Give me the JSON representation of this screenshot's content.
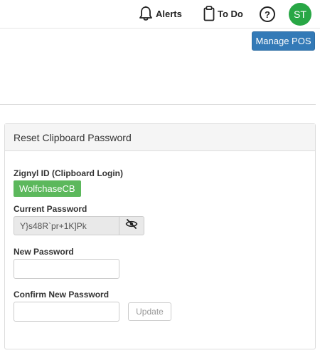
{
  "header": {
    "alerts_label": "Alerts",
    "todo_label": "To Do",
    "help_label": "?",
    "avatar_initials": "ST",
    "avatar_color": "#28a745"
  },
  "actions": {
    "manage_pos_label": "Manage POS",
    "accent_color": "#337ab7"
  },
  "panel": {
    "title": "Reset Clipboard Password",
    "zignyl_id_label": "Zignyl ID (Clipboard Login)",
    "zignyl_id_value": "WolfchaseCB",
    "current_password_label": "Current Password",
    "current_password_value": "Y}s48R`pr+1K]Pk",
    "toggle_icon": "eye-slash-icon",
    "new_password_label": "New Password",
    "new_password_value": "",
    "confirm_password_label": "Confirm New Password",
    "confirm_password_value": "",
    "update_label": "Update"
  }
}
